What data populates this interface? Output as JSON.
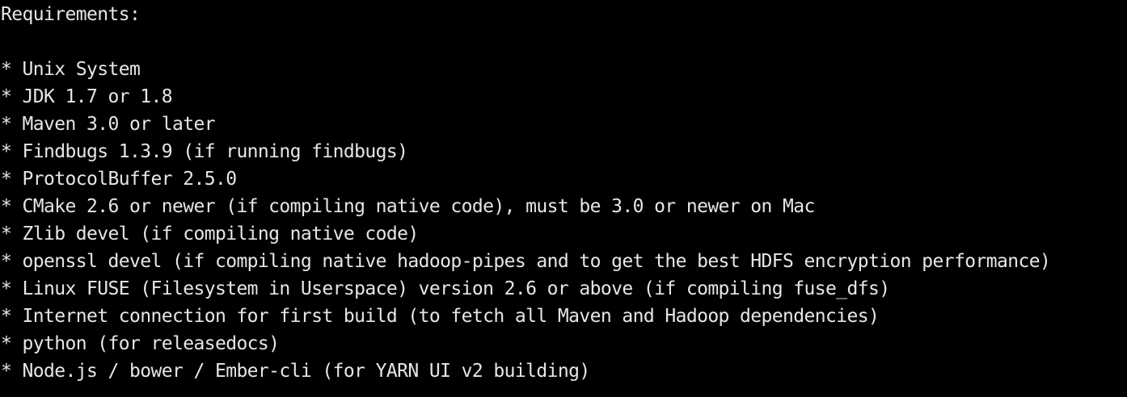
{
  "terminal": {
    "heading": "Requirements:",
    "items": [
      "* Unix System",
      "* JDK 1.7 or 1.8",
      "* Maven 3.0 or later",
      "* Findbugs 1.3.9 (if running findbugs)",
      "* ProtocolBuffer 2.5.0",
      "* CMake 2.6 or newer (if compiling native code), must be 3.0 or newer on Mac",
      "* Zlib devel (if compiling native code)",
      "* openssl devel (if compiling native hadoop-pipes and to get the best HDFS encryption performance)",
      "* Linux FUSE (Filesystem in Userspace) version 2.6 or above (if compiling fuse_dfs)",
      "* Internet connection for first build (to fetch all Maven and Hadoop dependencies)",
      "* python (for releasedocs)",
      "* Node.js / bower / Ember-cli (for YARN UI v2 building)"
    ]
  }
}
